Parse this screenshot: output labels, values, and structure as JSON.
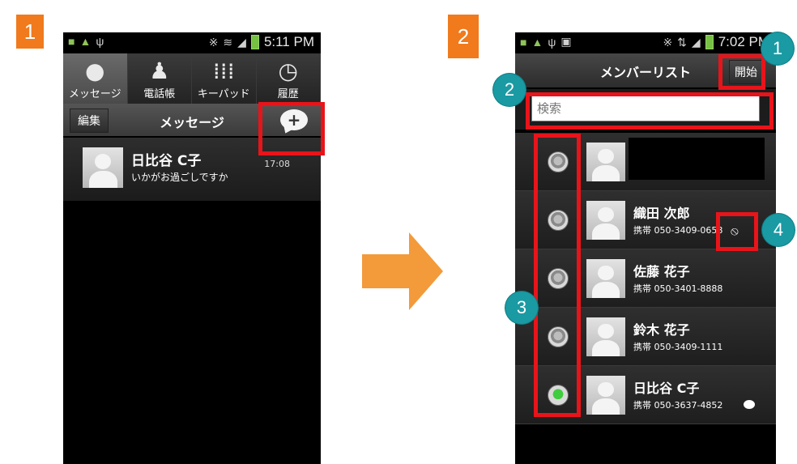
{
  "steps": {
    "step1": "1",
    "step2": "2"
  },
  "callouts": {
    "c1": "1",
    "c2": "2",
    "c3": "3",
    "c4": "4"
  },
  "phone1": {
    "status_time": "5:11 PM",
    "tabs": [
      {
        "label": "メッセージ",
        "icon": "speech-bubble-icon"
      },
      {
        "label": "電話帳",
        "icon": "person-icon"
      },
      {
        "label": "キーパッド",
        "icon": "keypad-icon"
      },
      {
        "label": "履歴",
        "icon": "clock-icon"
      }
    ],
    "edit_label": "編集",
    "header_title": "メッセージ",
    "thread": {
      "name": "日比谷 C子",
      "snippet": "いかがお過ごしですか",
      "time": "17:08"
    }
  },
  "phone2": {
    "status_time": "7:02 PM",
    "title": "メンバーリスト",
    "start_label": "開始",
    "search_placeholder": "検索",
    "contacts": [
      {
        "name": "",
        "phone": "",
        "selected": false
      },
      {
        "name": "織田 次郎",
        "phone": "携帯 050-3409-0658",
        "selected": false
      },
      {
        "name": "佐藤 花子",
        "phone": "携帯 050-3401-8888",
        "selected": false
      },
      {
        "name": "鈴木 花子",
        "phone": "携帯 050-3409-1111",
        "selected": false
      },
      {
        "name": "日比谷 C子",
        "phone": "携帯 050-3637-4852",
        "selected": true
      }
    ]
  },
  "colors": {
    "step_orange": "#f07a1c",
    "highlight_red": "#e8141a",
    "callout_teal": "#1a9aa3",
    "arrow": "#f39a3a"
  }
}
